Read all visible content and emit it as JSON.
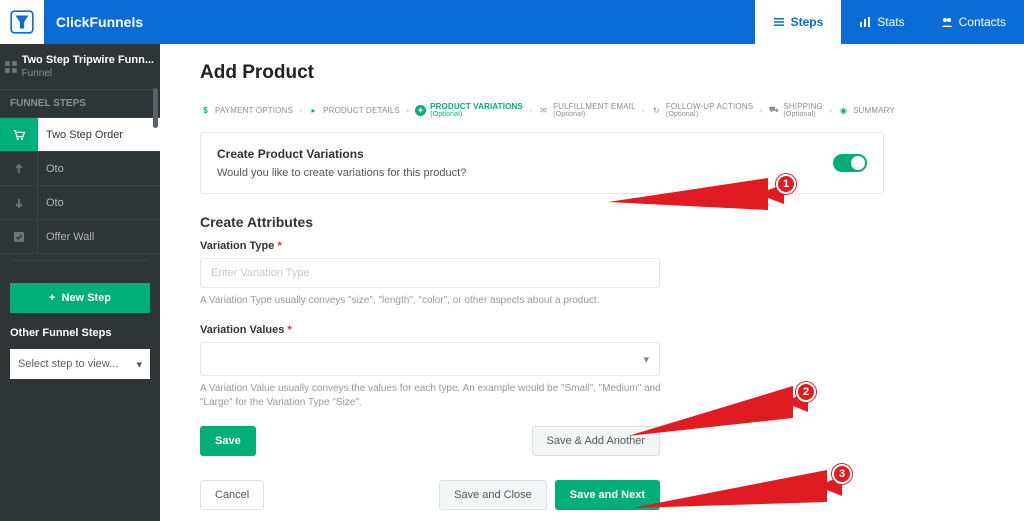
{
  "top": {
    "brand": "ClickFunnels",
    "tabs": {
      "steps": "Steps",
      "stats": "Stats",
      "contacts": "Contacts"
    }
  },
  "sidebar": {
    "funnel_name": "Two Step Tripwire Funn...",
    "funnel_sub": "Funnel",
    "section_label": "FUNNEL STEPS",
    "steps": [
      {
        "label": "Two Step Order"
      },
      {
        "label": "Oto"
      },
      {
        "label": "Oto"
      },
      {
        "label": "Offer Wall"
      }
    ],
    "new_step": "New Step",
    "other_label": "Other Funnel Steps",
    "other_select": "Select step to view..."
  },
  "page": {
    "title": "Add Product"
  },
  "wizard": {
    "s1": "PAYMENT OPTIONS",
    "s2": "PRODUCT DETAILS",
    "s3": "PRODUCT VARIATIONS",
    "s3_opt": "(Optional)",
    "s4": "FULFILLMENT EMAIL",
    "s4_opt": "(Optional)",
    "s5": "FOLLOW-UP ACTIONS",
    "s5_opt": "(Optional)",
    "s6": "SHIPPING",
    "s6_opt": "(Optional)",
    "s7": "SUMMARY"
  },
  "panel": {
    "title": "Create Product Variations",
    "desc": "Would you like to create variations for this product?"
  },
  "attrs": {
    "title": "Create Attributes",
    "type_label": "Variation Type",
    "type_placeholder": "Enter Variation Type",
    "type_help": "A Variation Type usually conveys \"size\", \"length\", \"color\", or other aspects about a product.",
    "values_label": "Variation Values",
    "values_help": "A Variation Value usually conveys the values for each type. An example would be \"Small\", \"Medium\" and \"Large\" for the Variation Type \"Size\"."
  },
  "buttons": {
    "save": "Save",
    "save_add": "Save & Add Another",
    "cancel": "Cancel",
    "save_close": "Save and Close",
    "save_next": "Save and Next"
  },
  "callouts": {
    "n1": "1",
    "n2": "2",
    "n3": "3"
  }
}
